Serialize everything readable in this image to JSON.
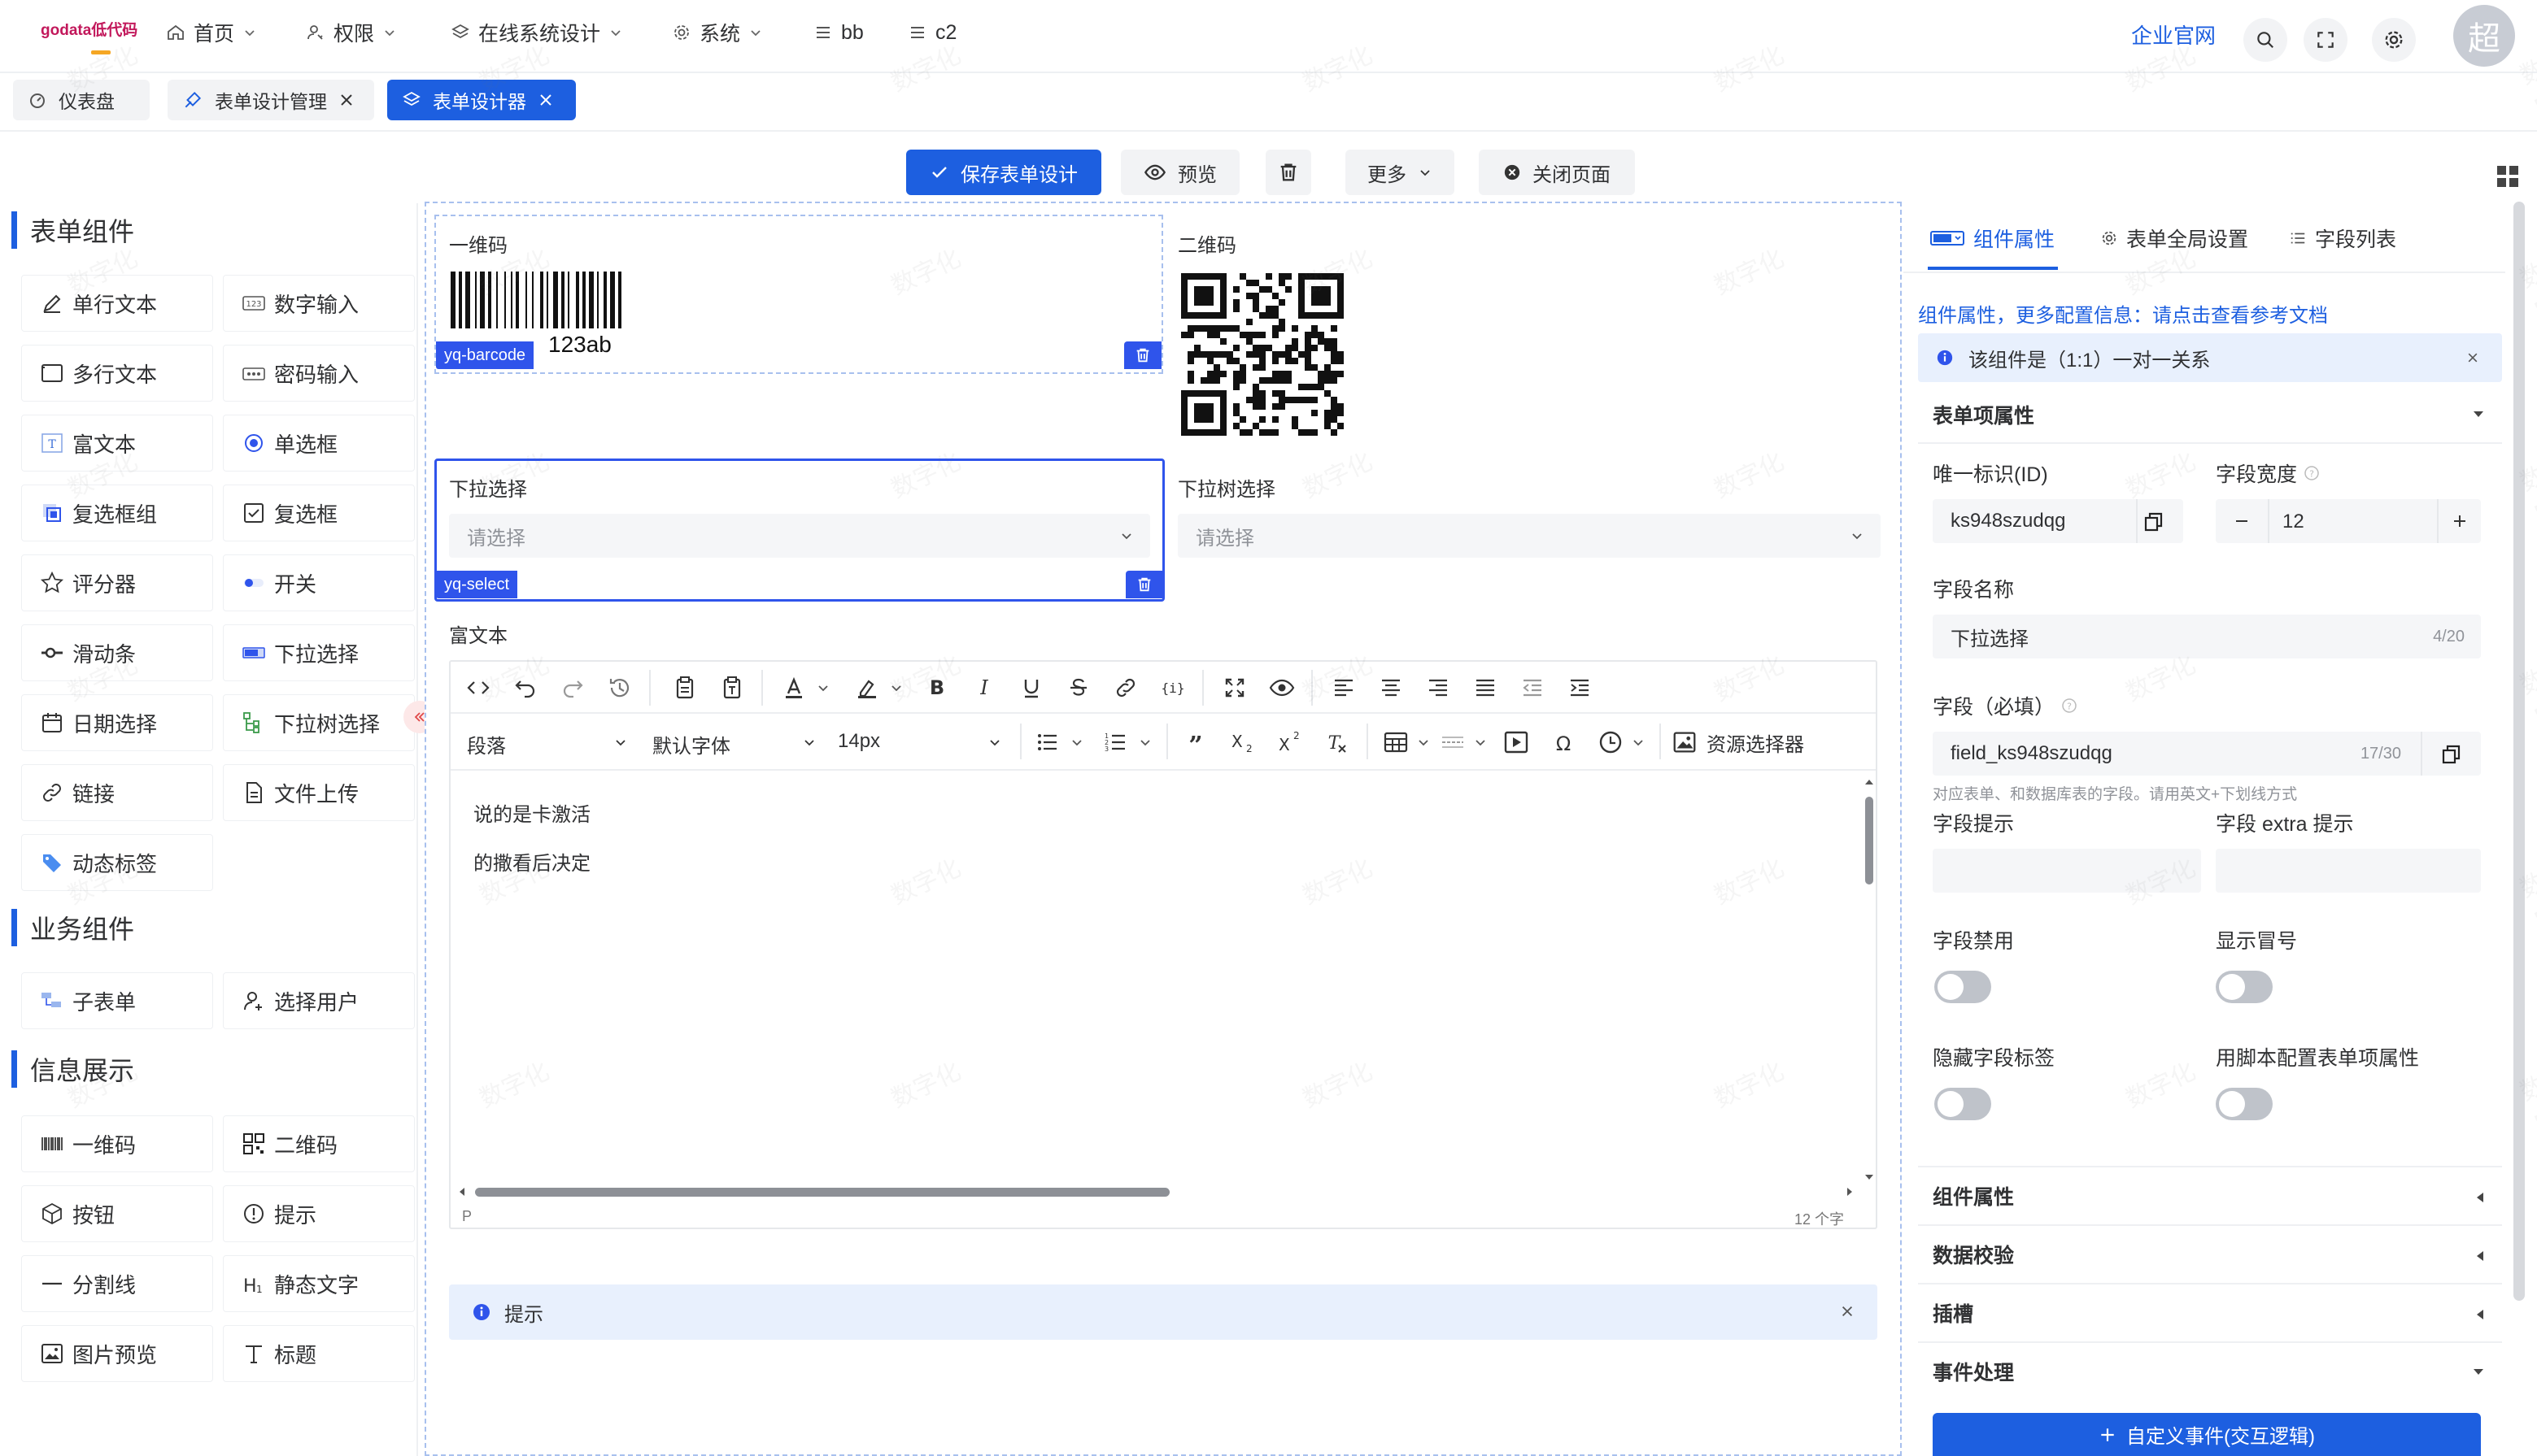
{
  "header": {
    "logo": "godata低代码",
    "menu": [
      {
        "label": "首页",
        "icon": "home-icon"
      },
      {
        "label": "权限",
        "icon": "user-key-icon"
      },
      {
        "label": "在线系统设计",
        "icon": "layers-icon"
      },
      {
        "label": "系统",
        "icon": "gear-icon"
      },
      {
        "label": "bb",
        "icon": "list-icon"
      },
      {
        "label": "c2",
        "icon": "list-icon"
      }
    ],
    "official_link": "企业官网",
    "avatar_text": "超"
  },
  "tabs": [
    {
      "label": "仪表盘",
      "icon": "dashboard-icon",
      "closable": false
    },
    {
      "label": "表单设计管理",
      "icon": "design-icon",
      "closable": true
    },
    {
      "label": "表单设计器",
      "icon": "layers-icon",
      "closable": true,
      "active": true
    }
  ],
  "toolbar": {
    "save": "保存表单设计",
    "preview": "预览",
    "more": "更多",
    "close_page": "关闭页面"
  },
  "palette": {
    "sections": [
      {
        "title": "表单组件",
        "items": [
          {
            "label": "单行文本",
            "icon": "edit-icon"
          },
          {
            "label": "数字输入",
            "icon": "number-icon"
          },
          {
            "label": "多行文本",
            "icon": "textarea-icon"
          },
          {
            "label": "密码输入",
            "icon": "password-icon"
          },
          {
            "label": "富文本",
            "icon": "richtext-icon"
          },
          {
            "label": "单选框",
            "icon": "radio-icon"
          },
          {
            "label": "复选框组",
            "icon": "checkbox-group-icon"
          },
          {
            "label": "复选框",
            "icon": "checkbox-icon"
          },
          {
            "label": "评分器",
            "icon": "star-icon"
          },
          {
            "label": "开关",
            "icon": "switch-icon"
          },
          {
            "label": "滑动条",
            "icon": "slider-icon"
          },
          {
            "label": "下拉选择",
            "icon": "select-icon"
          },
          {
            "label": "日期选择",
            "icon": "calendar-icon"
          },
          {
            "label": "下拉树选择",
            "icon": "tree-icon"
          },
          {
            "label": "链接",
            "icon": "link-icon"
          },
          {
            "label": "文件上传",
            "icon": "file-icon"
          },
          {
            "label": "动态标签",
            "icon": "tag-icon"
          }
        ]
      },
      {
        "title": "业务组件",
        "items": [
          {
            "label": "子表单",
            "icon": "subform-icon"
          },
          {
            "label": "选择用户",
            "icon": "user-add-icon"
          }
        ]
      },
      {
        "title": "信息展示",
        "items": [
          {
            "label": "一维码",
            "icon": "barcode-icon"
          },
          {
            "label": "二维码",
            "icon": "qrcode-icon"
          },
          {
            "label": "按钮",
            "icon": "cube-icon"
          },
          {
            "label": "提示",
            "icon": "alert-icon"
          },
          {
            "label": "分割线",
            "icon": "divider-icon"
          },
          {
            "label": "静态文字",
            "icon": "heading-icon"
          },
          {
            "label": "图片预览",
            "icon": "image-icon"
          },
          {
            "label": "标题",
            "icon": "text-icon"
          }
        ]
      }
    ]
  },
  "canvas": {
    "barcode": {
      "label": "一维码",
      "tag": "yq-barcode",
      "value": "123ab"
    },
    "qrcode": {
      "label": "二维码"
    },
    "dropdown": {
      "label": "下拉选择",
      "tag": "yq-select",
      "placeholder": "请选择"
    },
    "tree_select": {
      "label": "下拉树选择",
      "placeholder": "请选择"
    },
    "richtext": {
      "label": "富文本",
      "paragraph": "段落",
      "font": "默认字体",
      "size": "14px",
      "resource": "资源选择器",
      "lines": [
        "说的是卡激活",
        "的撒看后决定"
      ],
      "path": "P",
      "count": "12 个字"
    },
    "alert": {
      "text": "提示"
    }
  },
  "props": {
    "tabs": [
      {
        "label": "组件属性",
        "active": true
      },
      {
        "label": "表单全局设置"
      },
      {
        "label": "字段列表"
      }
    ],
    "doc_link": "组件属性，更多配置信息：请点击查看参考文档",
    "info": "该组件是（1:1）一对一关系",
    "section_title": "表单项属性",
    "id_label": "唯一标识(ID)",
    "id_value": "ks948szudqg",
    "width_label": "字段宽度",
    "width_value": "12",
    "name_label": "字段名称",
    "name_value": "下拉选择",
    "name_count": "4/20",
    "field_label": "字段（必填）",
    "field_value": "field_ks948szudqg",
    "field_count": "17/30",
    "field_hint": "对应表单、和数据库表的字段。请用英文+下划线方式",
    "tip_label": "字段提示",
    "extra_label": "字段 extra 提示",
    "disabled_label": "字段禁用",
    "colon_label": "显示冒号",
    "hide_label_label": "隐藏字段标签",
    "script_label": "用脚本配置表单项属性",
    "collapses": [
      "组件属性",
      "数据校验",
      "插槽",
      "事件处理"
    ],
    "custom_event_button": "自定义事件(交互逻辑)"
  },
  "watermark": "数字化"
}
